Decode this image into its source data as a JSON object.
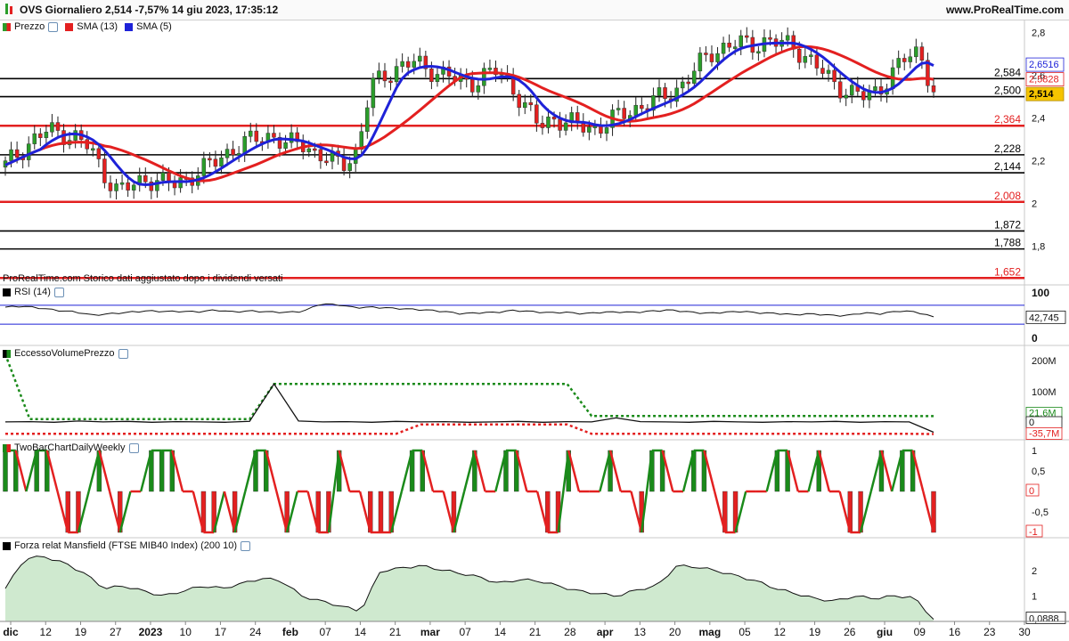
{
  "title": "OVS Giornaliero 2,514 -7,57% 14 giu 2023, 17:35:12",
  "site": "www.ProRealTime.com",
  "legends": {
    "price": "Prezzo",
    "sma13": "SMA (13)",
    "sma5": "SMA (5)",
    "rsi": "RSI (14)",
    "excess": "EccessoVolumePrezzo",
    "twobar": "TwoBarChartDailyWeekly",
    "mansfield": "Forza relat Mansfield (FTSE MIB40 Index) (200 10)"
  },
  "footnote": "ProRealTime.com  Storico dati aggiustato dopo i dividendi versati",
  "colors": {
    "up": "#2a9d2a",
    "down": "#e32020",
    "sma13": "#e32020",
    "sma5": "#1e22d8",
    "level_black": "#000000",
    "level_red": "#e32020",
    "twobar_up": "#1a8a1a",
    "twobar_down": "#e32020",
    "mansfield_fill": "#cfe9cf",
    "current": "#f5c400"
  },
  "chart_data": [
    {
      "type": "candlestick",
      "panel": "price",
      "ylim": [
        1.62,
        2.86
      ],
      "y_ticks": [
        "2,8",
        "2,6",
        "2,4",
        "2,2",
        "2",
        "1,8"
      ],
      "x_tick_labels": [
        "dic",
        "12",
        "19",
        "27",
        "2023",
        "10",
        "17",
        "24",
        "feb",
        "07",
        "14",
        "21",
        "mar",
        "07",
        "14",
        "21",
        "28",
        "apr",
        "13",
        "20",
        "mag",
        "05",
        "12",
        "19",
        "26",
        "giu",
        "09",
        "16",
        "23",
        "30"
      ],
      "close_series": [
        2.18,
        2.24,
        2.3,
        2.34,
        2.33,
        2.31,
        2.26,
        2.14,
        2.06,
        2.08,
        2.12,
        2.1,
        2.09,
        2.12,
        2.16,
        2.2,
        2.25,
        2.28,
        2.31,
        2.32,
        2.27,
        2.29,
        2.24,
        2.2,
        2.19,
        2.24,
        2.55,
        2.6,
        2.64,
        2.66,
        2.63,
        2.61,
        2.58,
        2.56,
        2.6,
        2.62,
        2.55,
        2.45,
        2.36,
        2.4,
        2.38,
        2.36,
        2.35,
        2.39,
        2.42,
        2.45,
        2.48,
        2.5,
        2.55,
        2.62,
        2.7,
        2.73,
        2.75,
        2.74,
        2.76,
        2.75,
        2.74,
        2.68,
        2.62,
        2.56,
        2.52,
        2.5,
        2.53,
        2.6,
        2.68,
        2.72,
        2.514
      ],
      "levels": [
        {
          "value": 2.584,
          "label": "2,584",
          "color": "black"
        },
        {
          "value": 2.5,
          "label": "2,500",
          "color": "black"
        },
        {
          "value": 2.364,
          "label": "2,364",
          "color": "red"
        },
        {
          "value": 2.228,
          "label": "2,228",
          "color": "black"
        },
        {
          "value": 2.144,
          "label": "2,144",
          "color": "black"
        },
        {
          "value": 2.008,
          "label": "2,008",
          "color": "red"
        },
        {
          "value": 1.872,
          "label": "1,872",
          "color": "black"
        },
        {
          "value": 1.788,
          "label": "1,788",
          "color": "black"
        },
        {
          "value": 1.652,
          "label": "1,652",
          "color": "red"
        }
      ],
      "last_values": [
        {
          "label": "2,6516",
          "value": 2.6516,
          "series": "SMA (5)"
        },
        {
          "label": "2,5828",
          "value": 2.5828,
          "series": "SMA (13)"
        },
        {
          "label": "2,514",
          "value": 2.514,
          "series": "Prezzo"
        }
      ]
    },
    {
      "type": "line",
      "panel": "rsi",
      "ylim": [
        0,
        100
      ],
      "y_ticks": [
        "100",
        "0"
      ],
      "guides": [
        70,
        30
      ],
      "values": [
        66,
        68,
        64,
        59,
        56,
        49,
        52,
        55,
        58,
        57,
        57,
        56,
        60,
        56,
        58,
        56,
        55,
        57,
        73,
        71,
        65,
        66,
        64,
        62,
        60,
        57,
        52,
        54,
        55,
        59,
        57,
        54,
        55,
        52,
        55,
        56,
        55,
        58,
        60,
        56,
        53,
        55,
        57,
        54,
        53,
        50,
        52,
        49,
        48,
        54,
        52,
        58,
        56,
        45
      ],
      "last_label": "42,745"
    },
    {
      "type": "line",
      "panel": "excess",
      "y_ticks": [
        "200M",
        "100M"
      ],
      "series": [
        {
          "values": [
            220,
            12,
            12,
            12,
            12,
            12,
            12,
            12,
            12,
            12,
            12,
            125,
            125,
            125,
            125,
            125,
            125,
            125,
            125,
            125,
            125,
            125,
            125,
            125,
            22,
            22,
            22,
            22,
            22,
            22,
            22,
            22,
            22,
            22,
            22,
            22,
            22,
            22,
            21.6
          ]
        },
        {
          "values": [
            -35,
            -35,
            -35,
            -35,
            -35,
            -35,
            -35,
            -35,
            -35,
            -35,
            -35,
            -35,
            -35,
            -35,
            -35,
            -35,
            -35,
            -5,
            -5,
            -5,
            -5,
            -5,
            -5,
            -5,
            -35,
            -35,
            -35,
            -35,
            -35,
            -35,
            -35,
            -35,
            -35,
            -35,
            -35,
            -35,
            -35,
            -35,
            -35.7
          ]
        },
        {
          "values": [
            3,
            4,
            2,
            6,
            3,
            5,
            2,
            4,
            3,
            2,
            5,
            125,
            6,
            3,
            4,
            2,
            5,
            3,
            4,
            2,
            3,
            5,
            2,
            4,
            3,
            16,
            4,
            3,
            2,
            5,
            3,
            2,
            4,
            3,
            5,
            2,
            4,
            3,
            -30
          ]
        }
      ],
      "last_labels": [
        "21,6M",
        "-35,7M",
        "0"
      ]
    },
    {
      "type": "step",
      "panel": "twobar",
      "ylim": [
        -1,
        1
      ],
      "y_ticks": [
        "1",
        "0,5",
        "0",
        "-0,5",
        "-1"
      ],
      "values": [
        1,
        1,
        0,
        1,
        1,
        0,
        -1,
        -1,
        0,
        1,
        0,
        -1,
        0,
        0,
        1,
        1,
        1,
        0,
        0,
        -1,
        -1,
        0,
        -1,
        0,
        1,
        1,
        0,
        -1,
        0,
        0,
        -1,
        -1,
        1,
        0,
        0,
        -1,
        -1,
        -1,
        0,
        1,
        1,
        0,
        0,
        -1,
        0,
        1,
        0,
        0,
        1,
        1,
        0,
        0,
        -1,
        -1,
        1,
        0,
        0,
        0,
        1,
        0,
        0,
        -1,
        1,
        1,
        0,
        0,
        1,
        1,
        0,
        -1,
        -1,
        0,
        0,
        0,
        1,
        1,
        0,
        0,
        1,
        0,
        0,
        -1,
        -1,
        0,
        1,
        0,
        1,
        1,
        0,
        -1
      ],
      "last_labels": [
        "0",
        "-1"
      ]
    },
    {
      "type": "area",
      "panel": "mansfield",
      "y_ticks": [
        "2",
        "1"
      ],
      "values": [
        1.3,
        2.5,
        2.55,
        2.3,
        1.9,
        1.3,
        1.4,
        1.2,
        1.0,
        1.2,
        1.4,
        1.3,
        1.5,
        1.7,
        1.6,
        1.0,
        0.8,
        0.6,
        0.4,
        2.0,
        2.1,
        2.2,
        2.05,
        1.9,
        1.75,
        1.5,
        1.65,
        1.6,
        1.4,
        1.2,
        1.1,
        1.0,
        1.25,
        1.4,
        2.2,
        2.15,
        2.0,
        1.8,
        1.6,
        1.3,
        1.1,
        0.9,
        0.8,
        1.0,
        0.9,
        1.0,
        0.95,
        0.09
      ],
      "last_label": "0,0888"
    }
  ]
}
